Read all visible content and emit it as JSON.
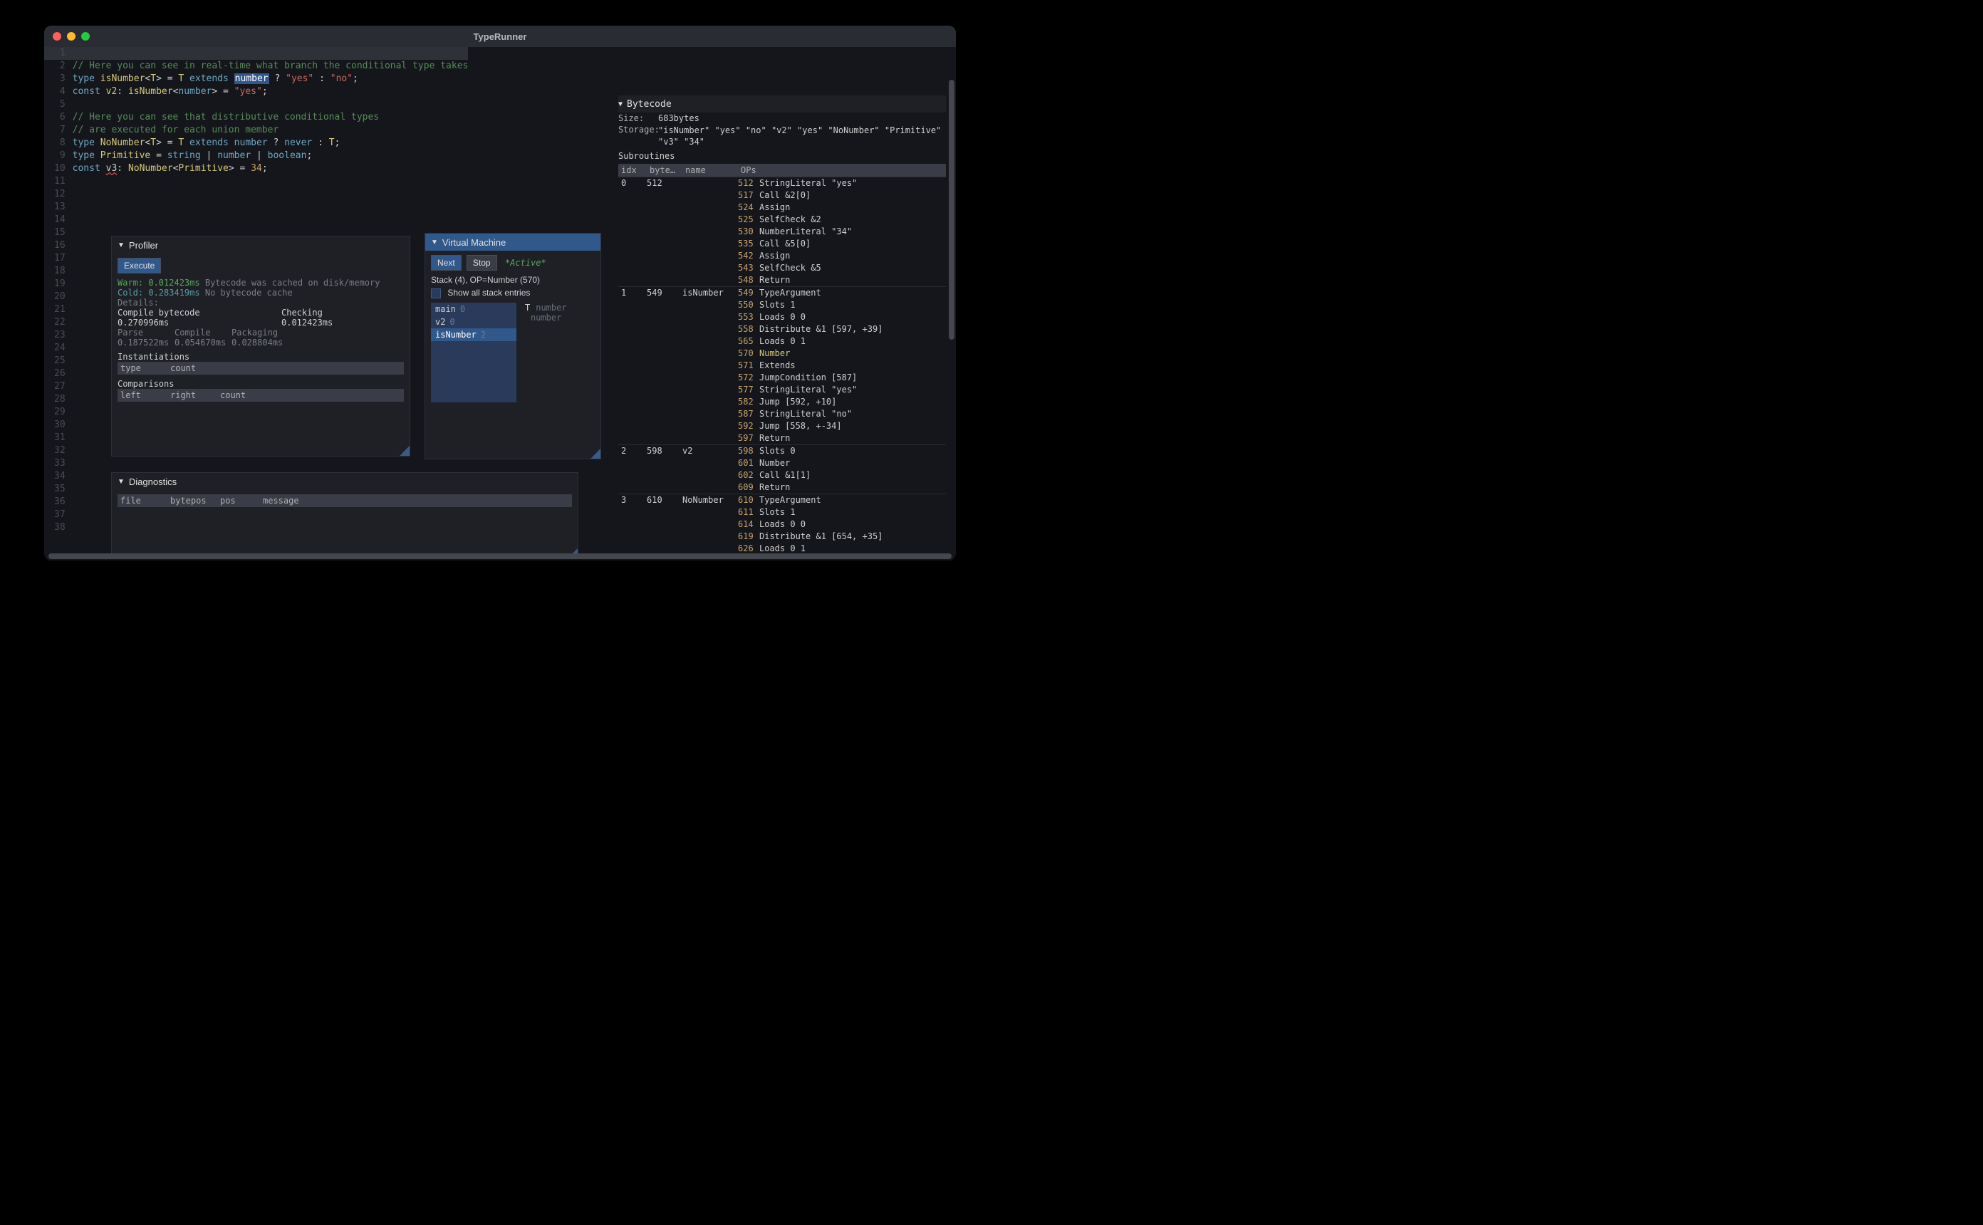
{
  "title": "TypeRunner",
  "editor": {
    "lines": [
      {
        "n": 1,
        "hl": true,
        "tokens": []
      },
      {
        "n": 2,
        "tokens": [
          [
            "comment",
            "// Here you can see in real-time what branch the conditional type takes"
          ]
        ]
      },
      {
        "n": 3,
        "tokens": [
          [
            "kw",
            "type"
          ],
          [
            "plain",
            " "
          ],
          [
            "ident",
            "isNumber"
          ],
          [
            "plain",
            "<"
          ],
          [
            "ident",
            "T"
          ],
          [
            "plain",
            "> = "
          ],
          [
            "ident",
            "T"
          ],
          [
            "plain",
            " "
          ],
          [
            "kw",
            "extends"
          ],
          [
            "plain",
            " "
          ],
          [
            "sel",
            "number"
          ],
          [
            "plain",
            " ? "
          ],
          [
            "str",
            "\"yes\""
          ],
          [
            "plain",
            " : "
          ],
          [
            "str",
            "\"no\""
          ],
          [
            "plain",
            ";"
          ]
        ]
      },
      {
        "n": 4,
        "tokens": [
          [
            "kw",
            "const"
          ],
          [
            "plain",
            " "
          ],
          [
            "ident",
            "v2"
          ],
          [
            "plain",
            ": "
          ],
          [
            "ident",
            "isNumber"
          ],
          [
            "plain",
            "<"
          ],
          [
            "type",
            "number"
          ],
          [
            "plain",
            "> = "
          ],
          [
            "str",
            "\"yes\""
          ],
          [
            "plain",
            ";"
          ]
        ]
      },
      {
        "n": 5,
        "tokens": []
      },
      {
        "n": 6,
        "tokens": [
          [
            "comment",
            "// Here you can see that distributive conditional types"
          ]
        ]
      },
      {
        "n": 7,
        "tokens": [
          [
            "comment",
            "// are executed for each union member"
          ]
        ]
      },
      {
        "n": 8,
        "tokens": [
          [
            "kw",
            "type"
          ],
          [
            "plain",
            " "
          ],
          [
            "ident",
            "NoNumber"
          ],
          [
            "plain",
            "<"
          ],
          [
            "ident",
            "T"
          ],
          [
            "plain",
            "> = "
          ],
          [
            "ident",
            "T"
          ],
          [
            "plain",
            " "
          ],
          [
            "kw",
            "extends"
          ],
          [
            "plain",
            " "
          ],
          [
            "type",
            "number"
          ],
          [
            "plain",
            " ? "
          ],
          [
            "kw",
            "never"
          ],
          [
            "plain",
            " : "
          ],
          [
            "ident",
            "T"
          ],
          [
            "plain",
            ";"
          ]
        ]
      },
      {
        "n": 9,
        "tokens": [
          [
            "kw",
            "type"
          ],
          [
            "plain",
            " "
          ],
          [
            "ident",
            "Primitive"
          ],
          [
            "plain",
            " = "
          ],
          [
            "type",
            "string"
          ],
          [
            "plain",
            " | "
          ],
          [
            "type",
            "number"
          ],
          [
            "plain",
            " | "
          ],
          [
            "type",
            "boolean"
          ],
          [
            "plain",
            ";"
          ]
        ]
      },
      {
        "n": 10,
        "tokens": [
          [
            "kw",
            "const"
          ],
          [
            "plain",
            " "
          ],
          [
            "err",
            "v3"
          ],
          [
            "plain",
            ": "
          ],
          [
            "ident",
            "NoNumber"
          ],
          [
            "plain",
            "<"
          ],
          [
            "ident",
            "Primitive"
          ],
          [
            "plain",
            "> = "
          ],
          [
            "num",
            "34"
          ],
          [
            "plain",
            ";"
          ]
        ]
      },
      {
        "n": 11,
        "tokens": []
      },
      {
        "n": 12,
        "tokens": []
      },
      {
        "n": 13,
        "tokens": []
      },
      {
        "n": 14,
        "tokens": []
      },
      {
        "n": 15,
        "tokens": []
      },
      {
        "n": 16,
        "tokens": []
      },
      {
        "n": 17,
        "tokens": []
      },
      {
        "n": 18,
        "tokens": []
      },
      {
        "n": 19,
        "tokens": []
      },
      {
        "n": 20,
        "tokens": []
      },
      {
        "n": 21,
        "tokens": []
      },
      {
        "n": 22,
        "tokens": []
      },
      {
        "n": 23,
        "tokens": []
      },
      {
        "n": 24,
        "tokens": []
      },
      {
        "n": 25,
        "tokens": []
      },
      {
        "n": 26,
        "tokens": []
      },
      {
        "n": 27,
        "tokens": []
      },
      {
        "n": 28,
        "tokens": []
      },
      {
        "n": 29,
        "tokens": []
      },
      {
        "n": 30,
        "tokens": []
      },
      {
        "n": 31,
        "tokens": []
      },
      {
        "n": 32,
        "tokens": []
      },
      {
        "n": 33,
        "tokens": []
      },
      {
        "n": 34,
        "tokens": []
      },
      {
        "n": 35,
        "tokens": []
      },
      {
        "n": 36,
        "tokens": []
      },
      {
        "n": 37,
        "tokens": []
      },
      {
        "n": 38,
        "tokens": []
      }
    ]
  },
  "profiler": {
    "title": "Profiler",
    "execute": "Execute",
    "warm_label": "Warm:",
    "warm_time": "0.012423ms",
    "warm_note": "Bytecode was cached on disk/memory",
    "cold_label": "Cold:",
    "cold_time": "0.283419ms",
    "cold_note": "No bytecode cache",
    "details": "Details:",
    "compile_label": "Compile bytecode",
    "compile_time": "0.270996ms",
    "checking_label": "Checking",
    "checking_time": "0.012423ms",
    "parse_label": "Parse",
    "parse_time": "0.187522ms",
    "compile2_label": "Compile",
    "compile2_time": "0.054670ms",
    "packaging_label": "Packaging",
    "packaging_time": "0.028804ms",
    "instantiations": "Instantiations",
    "inst_cols": [
      "type",
      "count"
    ],
    "comparisons": "Comparisons",
    "comp_cols": [
      "left",
      "right",
      "count"
    ]
  },
  "diagnostics": {
    "title": "Diagnostics",
    "cols": [
      "file",
      "bytepos",
      "pos",
      "message"
    ]
  },
  "vm": {
    "title": "Virtual Machine",
    "next": "Next",
    "stop": "Stop",
    "active": "*Active*",
    "stack_label": "Stack (4), OP=Number (570)",
    "show_all": "Show all stack entries",
    "frames": [
      {
        "name": "main",
        "idx": "0"
      },
      {
        "name": "v2",
        "idx": "0"
      },
      {
        "name": "isNumber",
        "idx": "2",
        "sel": true
      }
    ],
    "vars": [
      {
        "name": "T",
        "type": "number"
      },
      {
        "name": "",
        "type": "number"
      }
    ]
  },
  "bytecode": {
    "title": "Bytecode",
    "size_label": "Size:",
    "size": "683bytes",
    "storage_label": "Storage:",
    "storage": "\"isNumber\" \"yes\" \"no\" \"v2\" \"yes\" \"NoNumber\" \"Primitive\" \"v3\" \"34\"",
    "subroutines_label": "Subroutines",
    "cols": [
      "idx",
      "byte…",
      "name",
      "OPs"
    ],
    "rows": [
      {
        "idx": "0",
        "byte": "512",
        "name": "",
        "ops": [
          [
            "512",
            "StringLiteral \"yes\""
          ],
          [
            "517",
            "Call &2[0]"
          ],
          [
            "524",
            "Assign"
          ],
          [
            "525",
            "SelfCheck &2"
          ],
          [
            "530",
            "NumberLiteral \"34\""
          ],
          [
            "535",
            "Call &5[0]"
          ],
          [
            "542",
            "Assign"
          ],
          [
            "543",
            "SelfCheck &5"
          ],
          [
            "548",
            "Return"
          ]
        ]
      },
      {
        "idx": "1",
        "byte": "549",
        "name": "isNumber",
        "ops": [
          [
            "549",
            "TypeArgument"
          ],
          [
            "550",
            "Slots 1"
          ],
          [
            "553",
            "Loads 0 0"
          ],
          [
            "558",
            "Distribute &1 [597, +39]"
          ],
          [
            "565",
            "Loads 0 1"
          ],
          [
            "570",
            "Number",
            "hl"
          ],
          [
            "571",
            "Extends"
          ],
          [
            "572",
            "JumpCondition [587]"
          ],
          [
            "577",
            "StringLiteral \"yes\""
          ],
          [
            "582",
            "Jump [592, +10]"
          ],
          [
            "587",
            "StringLiteral \"no\""
          ],
          [
            "592",
            "Jump [558, +-34]"
          ],
          [
            "597",
            "Return"
          ]
        ]
      },
      {
        "idx": "2",
        "byte": "598",
        "name": "v2",
        "ops": [
          [
            "598",
            "Slots 0"
          ],
          [
            "601",
            "Number"
          ],
          [
            "602",
            "Call &1[1]"
          ],
          [
            "609",
            "Return"
          ]
        ]
      },
      {
        "idx": "3",
        "byte": "610",
        "name": "NoNumber",
        "ops": [
          [
            "610",
            "TypeArgument"
          ],
          [
            "611",
            "Slots 1"
          ],
          [
            "614",
            "Loads 0 0"
          ],
          [
            "619",
            "Distribute &1 [654, +35]"
          ],
          [
            "626",
            "Loads 0 1"
          ]
        ]
      }
    ]
  }
}
